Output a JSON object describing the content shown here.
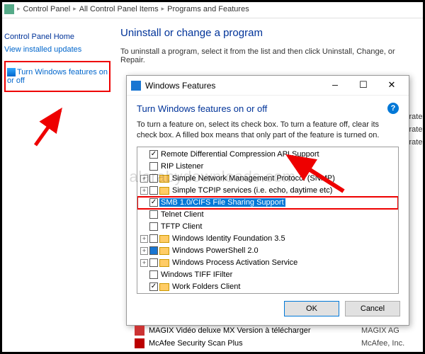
{
  "breadcrumb": {
    "a": "Control Panel",
    "b": "All Control Panel Items",
    "c": "Programs and Features"
  },
  "sidebar": {
    "home": "Control Panel Home",
    "updates": "View installed updates",
    "features": "Turn Windows features on or off"
  },
  "main": {
    "heading": "Uninstall or change a program",
    "sub": "To uninstall a program, select it from the list and then click Uninstall, Change, or Repair."
  },
  "bg_pubs": [
    "corporated",
    "corporated",
    "corporated"
  ],
  "dialog": {
    "title": "Windows Features",
    "heading": "Turn Windows features on or off",
    "desc": "To turn a feature on, select its check box. To turn a feature off, clear its check box. A filled box means that only part of the feature is turned on.",
    "items": [
      {
        "exp": false,
        "chk": "checked",
        "fld": false,
        "label": "Remote Differential Compression API Support"
      },
      {
        "exp": false,
        "chk": "",
        "fld": false,
        "label": "RIP Listener"
      },
      {
        "exp": true,
        "chk": "",
        "fld": true,
        "label": "Simple Network Management Protocol (SNMP)"
      },
      {
        "exp": true,
        "chk": "",
        "fld": true,
        "label": "Simple TCPIP services (i.e. echo, daytime etc)"
      },
      {
        "exp": false,
        "chk": "checked",
        "fld": false,
        "label": "SMB 1.0/CIFS File Sharing Support",
        "selected": true
      },
      {
        "exp": false,
        "chk": "",
        "fld": false,
        "label": "Telnet Client"
      },
      {
        "exp": false,
        "chk": "",
        "fld": false,
        "label": "TFTP Client"
      },
      {
        "exp": true,
        "chk": "",
        "fld": true,
        "label": "Windows Identity Foundation 3.5"
      },
      {
        "exp": true,
        "chk": "filled",
        "fld": true,
        "label": "Windows PowerShell 2.0"
      },
      {
        "exp": true,
        "chk": "",
        "fld": true,
        "label": "Windows Process Activation Service"
      },
      {
        "exp": false,
        "chk": "",
        "fld": false,
        "label": "Windows TIFF IFilter"
      },
      {
        "exp": false,
        "chk": "checked",
        "fld": true,
        "label": "Work Folders Client"
      }
    ],
    "ok": "OK",
    "cancel": "Cancel"
  },
  "bottom_programs": [
    {
      "name": "MAGIX Vidéo deluxe MX Version à télécharger",
      "pub": "MAGIX AG",
      "color": "#c33"
    },
    {
      "name": "McAfee Security Scan Plus",
      "pub": "McAfee, Inc.",
      "color": "#b00"
    }
  ],
  "watermark": "alarabydownloads.com"
}
